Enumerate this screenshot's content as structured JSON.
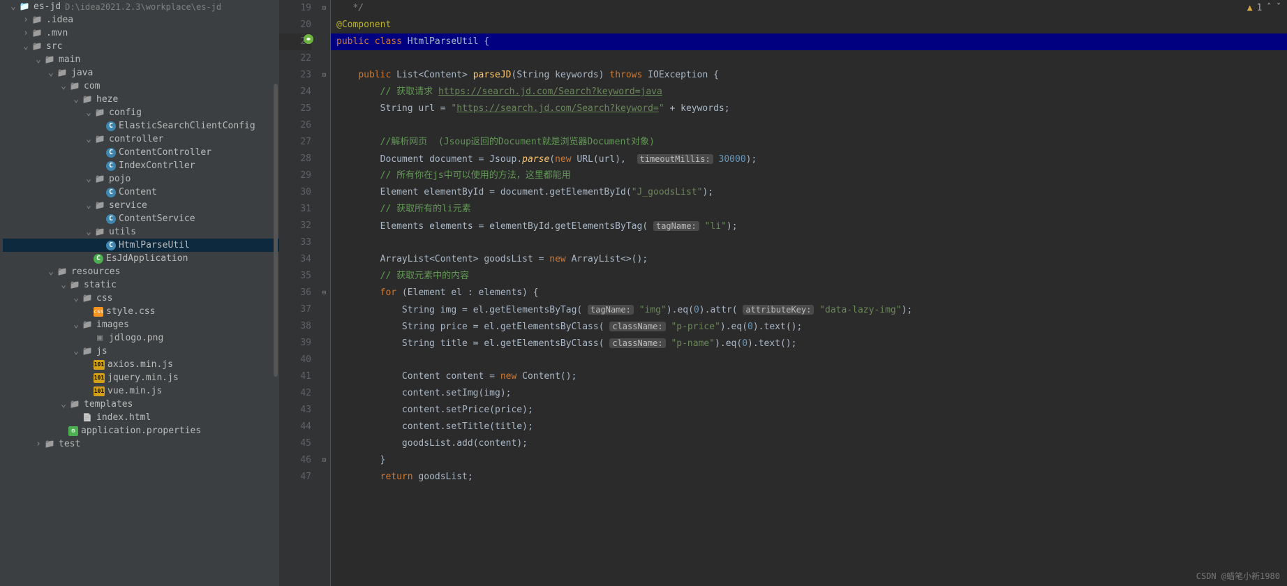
{
  "project": {
    "name": "es-jd",
    "path": "D:\\idea2021.2.3\\workplace\\es-jd"
  },
  "tree": [
    {
      "d": 0,
      "arrow": "v",
      "icon": "folder-icon root",
      "label": "es-jd",
      "pathExtra": true
    },
    {
      "d": 1,
      "arrow": ">",
      "icon": "folder-icon",
      "label": ".idea"
    },
    {
      "d": 1,
      "arrow": ">",
      "icon": "folder-icon",
      "label": ".mvn"
    },
    {
      "d": 1,
      "arrow": "v",
      "icon": "folder-icon",
      "label": "src"
    },
    {
      "d": 2,
      "arrow": "v",
      "icon": "folder-icon",
      "label": "main"
    },
    {
      "d": 3,
      "arrow": "v",
      "icon": "folder-icon",
      "label": "java"
    },
    {
      "d": 4,
      "arrow": "v",
      "icon": "folder-icon pkg",
      "label": "com"
    },
    {
      "d": 5,
      "arrow": "v",
      "icon": "folder-icon pkg",
      "label": "heze"
    },
    {
      "d": 6,
      "arrow": "v",
      "icon": "folder-icon pkg",
      "label": "config"
    },
    {
      "d": 7,
      "arrow": " ",
      "icon": "class-icon",
      "label": "ElasticSearchClientConfig"
    },
    {
      "d": 6,
      "arrow": "v",
      "icon": "folder-icon pkg",
      "label": "controller"
    },
    {
      "d": 7,
      "arrow": " ",
      "icon": "class-icon",
      "label": "ContentController"
    },
    {
      "d": 7,
      "arrow": " ",
      "icon": "class-icon",
      "label": "IndexContrller"
    },
    {
      "d": 6,
      "arrow": "v",
      "icon": "folder-icon pkg",
      "label": "pojo"
    },
    {
      "d": 7,
      "arrow": " ",
      "icon": "class-icon",
      "label": "Content"
    },
    {
      "d": 6,
      "arrow": "v",
      "icon": "folder-icon pkg",
      "label": "service"
    },
    {
      "d": 7,
      "arrow": " ",
      "icon": "class-icon",
      "label": "ContentService"
    },
    {
      "d": 6,
      "arrow": "v",
      "icon": "folder-icon pkg",
      "label": "utils"
    },
    {
      "d": 7,
      "arrow": " ",
      "icon": "class-icon",
      "label": "HtmlParseUtil",
      "selected": true
    },
    {
      "d": 6,
      "arrow": " ",
      "icon": "class-icon spring",
      "label": "EsJdApplication"
    },
    {
      "d": 3,
      "arrow": "v",
      "icon": "folder-icon",
      "label": "resources"
    },
    {
      "d": 4,
      "arrow": "v",
      "icon": "folder-icon",
      "label": "static"
    },
    {
      "d": 5,
      "arrow": "v",
      "icon": "folder-icon",
      "label": "css"
    },
    {
      "d": 6,
      "arrow": " ",
      "icon": "css-icon",
      "label": "style.css"
    },
    {
      "d": 5,
      "arrow": "v",
      "icon": "folder-icon",
      "label": "images"
    },
    {
      "d": 6,
      "arrow": " ",
      "icon": "png-icon",
      "label": "jdlogo.png"
    },
    {
      "d": 5,
      "arrow": "v",
      "icon": "folder-icon",
      "label": "js"
    },
    {
      "d": 6,
      "arrow": " ",
      "icon": "js-icon",
      "label": "axios.min.js"
    },
    {
      "d": 6,
      "arrow": " ",
      "icon": "js-icon",
      "label": "jquery.min.js"
    },
    {
      "d": 6,
      "arrow": " ",
      "icon": "js-icon",
      "label": "vue.min.js"
    },
    {
      "d": 4,
      "arrow": "v",
      "icon": "folder-icon",
      "label": "templates"
    },
    {
      "d": 5,
      "arrow": " ",
      "icon": "html-icon",
      "label": "index.html"
    },
    {
      "d": 4,
      "arrow": " ",
      "icon": "prop-icon",
      "label": "application.properties"
    },
    {
      "d": 2,
      "arrow": ">",
      "icon": "folder-icon",
      "label": "test"
    }
  ],
  "lines": [
    {
      "n": 19,
      "fold": "-",
      "t": "   <span class='com'>*/</span>"
    },
    {
      "n": 20,
      "t": "<span class='ann'>@Component</span>"
    },
    {
      "n": 21,
      "hl": true,
      "spring": true,
      "t": "<span class='kw'>public class</span> <span class='id'>HtmlParseUtil</span> {"
    },
    {
      "n": 22,
      "t": ""
    },
    {
      "n": 23,
      "fold": "-",
      "t": "    <span class='kw'>public</span> <span class='id'>List&lt;Content&gt;</span> <span class='fn'>parseJD</span>(<span class='id'>String keywords</span>) <span class='kw'>throws</span> <span class='id'>IOException</span> {"
    },
    {
      "n": 24,
      "t": "        <span class='com-chinese'>// 获取请求</span> <span class='url-str'>https://search.jd.com/Search?keyword=java</span>"
    },
    {
      "n": 25,
      "t": "        <span class='id'>String url</span> = <span class='str'>\"</span><span class='url-str'>https://search.jd.com/Search?keyword=</span><span class='str'>\"</span> + <span class='id'>keywords</span>;"
    },
    {
      "n": 26,
      "t": ""
    },
    {
      "n": 27,
      "t": "        <span class='com-chinese'>//解析网页  (Jsoup返回的Document就是浏览器Document对象)</span>"
    },
    {
      "n": 28,
      "t": "        <span class='id'>Document document</span> = <span class='id'>Jsoup</span>.<span class='fn-italic'>parse</span>(<span class='kw'>new</span> <span class='id'>URL</span>(<span class='id'>url</span>),  <span class='param-hint'>timeoutMillis:</span> <span class='num'>30000</span>);"
    },
    {
      "n": 29,
      "t": "        <span class='com-chinese'>// 所有你在js中可以使用的方法，这里都能用</span>"
    },
    {
      "n": 30,
      "t": "        <span class='id'>Element elementById</span> = <span class='id'>document</span>.<span class='id'>getElementById</span>(<span class='str'>\"J_goodsList\"</span>);"
    },
    {
      "n": 31,
      "t": "        <span class='com-chinese'>// 获取所有的li元素</span>"
    },
    {
      "n": 32,
      "t": "        <span class='id'>Elements elements</span> = <span class='id'>elementById</span>.<span class='id'>getElementsByTag</span>( <span class='param-hint'>tagName:</span> <span class='str'>\"li\"</span>);"
    },
    {
      "n": 33,
      "t": ""
    },
    {
      "n": 34,
      "t": "        <span class='id'>ArrayList&lt;Content&gt; goodsList</span> = <span class='kw'>new</span> <span class='id'>ArrayList&lt;&gt;</span>();"
    },
    {
      "n": 35,
      "t": "        <span class='com-chinese'>// 获取元素中的内容</span>"
    },
    {
      "n": 36,
      "fold": "-",
      "t": "        <span class='kw'>for</span> (<span class='id'>Element el</span> : <span class='id'>elements</span>) {"
    },
    {
      "n": 37,
      "t": "            <span class='id'>String img</span> = <span class='id'>el</span>.<span class='id'>getElementsByTag</span>( <span class='param-hint'>tagName:</span> <span class='str'>\"img\"</span>).<span class='id'>eq</span>(<span class='num'>0</span>).<span class='id'>attr</span>( <span class='param-hint'>attributeKey:</span> <span class='str'>\"data-lazy-img\"</span>);"
    },
    {
      "n": 38,
      "t": "            <span class='id'>String price</span> = <span class='id'>el</span>.<span class='id'>getElementsByClass</span>( <span class='param-hint'>className:</span> <span class='str'>\"p-price\"</span>).<span class='id'>eq</span>(<span class='num'>0</span>).<span class='id'>text</span>();"
    },
    {
      "n": 39,
      "t": "            <span class='id'>String title</span> = <span class='id'>el</span>.<span class='id'>getElementsByClass</span>( <span class='param-hint'>className:</span> <span class='str'>\"p-name\"</span>).<span class='id'>eq</span>(<span class='num'>0</span>).<span class='id'>text</span>();"
    },
    {
      "n": 40,
      "t": ""
    },
    {
      "n": 41,
      "t": "            <span class='id'>Content content</span> = <span class='kw'>new</span> <span class='id'>Content</span>();"
    },
    {
      "n": 42,
      "t": "            <span class='id'>content</span>.<span class='id'>setImg</span>(<span class='id'>img</span>);"
    },
    {
      "n": 43,
      "t": "            <span class='id'>content</span>.<span class='id'>setPrice</span>(<span class='id'>price</span>);"
    },
    {
      "n": 44,
      "t": "            <span class='id'>content</span>.<span class='id'>setTitle</span>(<span class='id'>title</span>);"
    },
    {
      "n": 45,
      "t": "            <span class='id'>goodsList</span>.<span class='id'>add</span>(<span class='id'>content</span>);"
    },
    {
      "n": 46,
      "fold": "-",
      "t": "        }"
    },
    {
      "n": 47,
      "t": "        <span class='kw'>return</span> <span class='id'>goodsList</span>;"
    }
  ],
  "status": {
    "warnings": "1",
    "nav_up": "^",
    "nav_down": "v"
  },
  "watermark": "CSDN @蜡笔小新1980"
}
